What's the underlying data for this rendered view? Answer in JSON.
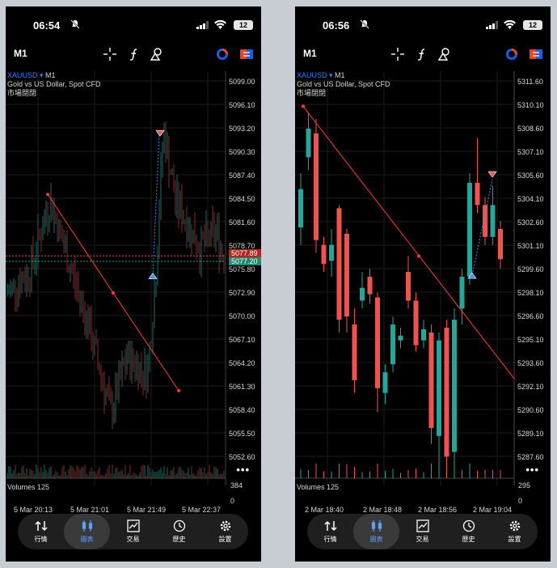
{
  "left": {
    "status": {
      "time": "06:54",
      "battery": "12"
    },
    "toolbar": {
      "timeframe": "M1"
    },
    "symbol": {
      "name": "XAUUSD",
      "timeframe": "M1",
      "description": "Gold vs US Dollar, Spot CFD",
      "market_status": "市場閉閉"
    },
    "y_axis": [
      "5099.00",
      "5096.10",
      "5093.20",
      "5090.30",
      "5087.40",
      "5084.50",
      "5081.60",
      "5078.70",
      "5075.80",
      "5072.90",
      "5070.00",
      "5067.10",
      "5064.20",
      "5061.30",
      "5058.40",
      "5055.50",
      "5052.60"
    ],
    "price_tags": {
      "ask": "5077.89",
      "bid": "5077.20"
    },
    "volumes": {
      "label": "Volumes 125",
      "max": "384",
      "min": "0"
    },
    "x_axis": [
      "5 Mar 20:13",
      "5 Mar 21:01",
      "5 Mar 21:49",
      "5 Mar 22:37"
    ]
  },
  "right": {
    "status": {
      "time": "06:56",
      "battery": "12"
    },
    "toolbar": {
      "timeframe": "M1"
    },
    "symbol": {
      "name": "XAUUSD",
      "timeframe": "M1",
      "description": "Gold vs US Dollar, Spot CFD",
      "market_status": "市場閉閉"
    },
    "y_axis": [
      "5311.60",
      "5310.10",
      "5308.60",
      "5307.10",
      "5305.60",
      "5304.10",
      "5302.60",
      "5301.10",
      "5299.60",
      "5298.10",
      "5296.60",
      "5295.10",
      "5293.60",
      "5292.10",
      "5290.60",
      "5289.10",
      "5287.60"
    ],
    "volumes": {
      "label": "Volumes 125",
      "max": "295",
      "min": "0"
    },
    "x_axis": [
      "2 Mar 18:40",
      "2 Mar 18:48",
      "2 Mar 18:56",
      "2 Mar 19:04"
    ],
    "chart_data": {
      "type": "candlestick",
      "candles": [
        {
          "o": 5302.6,
          "c": 5305.0,
          "h": 5306.0,
          "l": 5301.5
        },
        {
          "o": 5307.0,
          "c": 5308.8,
          "h": 5309.8,
          "l": 5306.2
        },
        {
          "o": 5308.5,
          "c": 5301.8,
          "h": 5309.4,
          "l": 5301.0
        },
        {
          "o": 5301.5,
          "c": 5300.3,
          "h": 5302.0,
          "l": 5299.8
        },
        {
          "o": 5300.5,
          "c": 5301.5,
          "h": 5302.5,
          "l": 5299.5
        },
        {
          "o": 5303.8,
          "c": 5296.8,
          "h": 5304.0,
          "l": 5296.0
        },
        {
          "o": 5302.2,
          "c": 5297.0,
          "h": 5302.5,
          "l": 5296.0
        },
        {
          "o": 5296.5,
          "c": 5293.0,
          "h": 5297.5,
          "l": 5292.2
        },
        {
          "o": 5298.0,
          "c": 5298.8,
          "h": 5299.8,
          "l": 5297.5
        },
        {
          "o": 5299.5,
          "c": 5298.4,
          "h": 5300.0,
          "l": 5297.8
        },
        {
          "o": 5298.2,
          "c": 5292.5,
          "h": 5298.5,
          "l": 5291.0
        },
        {
          "o": 5292.2,
          "c": 5293.5,
          "h": 5294.0,
          "l": 5291.5
        },
        {
          "o": 5294.0,
          "c": 5296.5,
          "h": 5297.0,
          "l": 5293.5
        },
        {
          "o": 5295.5,
          "c": 5295.8,
          "h": 5296.3,
          "l": 5295.0
        },
        {
          "o": 5299.8,
          "c": 5298.0,
          "h": 5300.8,
          "l": 5297.5
        },
        {
          "o": 5298.0,
          "c": 5295.2,
          "h": 5298.5,
          "l": 5294.8
        },
        {
          "o": 5295.5,
          "c": 5296.2,
          "h": 5296.8,
          "l": 5295.0
        },
        {
          "o": 5296.0,
          "c": 5290.0,
          "h": 5296.5,
          "l": 5289.0
        },
        {
          "o": 5289.5,
          "c": 5295.5,
          "h": 5296.0,
          "l": 5287.0
        },
        {
          "o": 5296.3,
          "c": 5288.2,
          "h": 5296.8,
          "l": 5287.5
        },
        {
          "o": 5288.5,
          "c": 5296.8,
          "h": 5297.5,
          "l": 5287.5
        },
        {
          "o": 5297.5,
          "c": 5299.5,
          "h": 5300.0,
          "l": 5296.5
        },
        {
          "o": 5299.5,
          "c": 5305.4,
          "h": 5306.0,
          "l": 5299.0
        },
        {
          "o": 5305.4,
          "c": 5304.0,
          "h": 5308.2,
          "l": 5303.5
        },
        {
          "o": 5304.0,
          "c": 5302.0,
          "h": 5304.5,
          "l": 5301.5
        },
        {
          "o": 5302.0,
          "c": 5304.0,
          "h": 5305.2,
          "l": 5301.5
        },
        {
          "o": 5302.5,
          "c": 5300.6,
          "h": 5303.0,
          "l": 5300.0
        }
      ],
      "ylim": [
        5287.0,
        5312.0
      ]
    }
  },
  "nav": [
    {
      "label": "行情",
      "icon": "quotes-icon"
    },
    {
      "label": "圖表",
      "icon": "chart-icon"
    },
    {
      "label": "交易",
      "icon": "trade-icon"
    },
    {
      "label": "歷史",
      "icon": "history-icon"
    },
    {
      "label": "設置",
      "icon": "settings-icon"
    }
  ],
  "colors": {
    "bull": "#26a69a",
    "bear": "#ef5350",
    "accent": "#3d7bf5",
    "trendline": "#ff3b30"
  }
}
